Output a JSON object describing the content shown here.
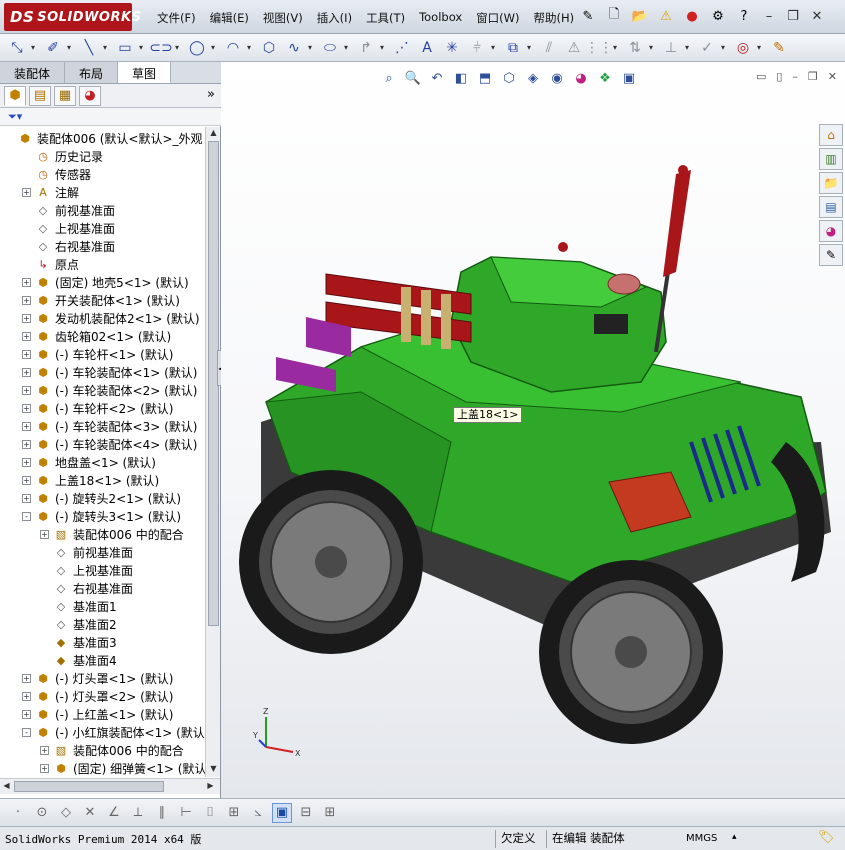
{
  "app": {
    "logo_ds": "DS",
    "logo_text": "SOLIDWORKS"
  },
  "menus": [
    "文件(F)",
    "编辑(E)",
    "视图(V)",
    "插入(I)",
    "工具(T)",
    "Toolbox",
    "窗口(W)",
    "帮助(H)"
  ],
  "command_manager_tabs": [
    "装配体",
    "布局",
    "草图"
  ],
  "active_command_tab": "草图",
  "feature_tree": [
    {
      "label": "装配体006  (默认<默认>_外观 显",
      "indent": 0,
      "expander": "",
      "icon": "asm"
    },
    {
      "label": "历史记录",
      "indent": 1,
      "expander": "",
      "icon": "hist"
    },
    {
      "label": "传感器",
      "indent": 1,
      "expander": "",
      "icon": "hist"
    },
    {
      "label": "注解",
      "indent": 1,
      "expander": "+",
      "icon": "note"
    },
    {
      "label": "前视基准面",
      "indent": 1,
      "expander": "",
      "icon": "plane"
    },
    {
      "label": "上视基准面",
      "indent": 1,
      "expander": "",
      "icon": "plane"
    },
    {
      "label": "右视基准面",
      "indent": 1,
      "expander": "",
      "icon": "plane"
    },
    {
      "label": "原点",
      "indent": 1,
      "expander": "",
      "icon": "orig"
    },
    {
      "label": "(固定) 地壳5<1> (默认)",
      "indent": 1,
      "expander": "+",
      "icon": "asm"
    },
    {
      "label": "开关装配体<1> (默认)",
      "indent": 1,
      "expander": "+",
      "icon": "asm"
    },
    {
      "label": "发动机装配体2<1> (默认)",
      "indent": 1,
      "expander": "+",
      "icon": "asm"
    },
    {
      "label": "齿轮箱02<1> (默认)",
      "indent": 1,
      "expander": "+",
      "icon": "asm"
    },
    {
      "label": "(-) 车轮杆<1> (默认)",
      "indent": 1,
      "expander": "+",
      "icon": "asm"
    },
    {
      "label": "(-) 车轮装配体<1> (默认)",
      "indent": 1,
      "expander": "+",
      "icon": "asm"
    },
    {
      "label": "(-) 车轮装配体<2> (默认)",
      "indent": 1,
      "expander": "+",
      "icon": "asm"
    },
    {
      "label": "(-) 车轮杆<2> (默认)",
      "indent": 1,
      "expander": "+",
      "icon": "asm"
    },
    {
      "label": "(-) 车轮装配体<3> (默认)",
      "indent": 1,
      "expander": "+",
      "icon": "asm"
    },
    {
      "label": "(-) 车轮装配体<4> (默认)",
      "indent": 1,
      "expander": "+",
      "icon": "asm"
    },
    {
      "label": "地盘盖<1> (默认)",
      "indent": 1,
      "expander": "+",
      "icon": "asm"
    },
    {
      "label": "上盖18<1> (默认)",
      "indent": 1,
      "expander": "+",
      "icon": "asm"
    },
    {
      "label": "(-) 旋转头2<1> (默认)",
      "indent": 1,
      "expander": "+",
      "icon": "asm"
    },
    {
      "label": "(-) 旋转头3<1> (默认)",
      "indent": 1,
      "expander": "-",
      "icon": "asm"
    },
    {
      "label": "装配体006 中的配合",
      "indent": 2,
      "expander": "+",
      "icon": "fold"
    },
    {
      "label": "前视基准面",
      "indent": 2,
      "expander": "",
      "icon": "plane"
    },
    {
      "label": "上视基准面",
      "indent": 2,
      "expander": "",
      "icon": "plane"
    },
    {
      "label": "右视基准面",
      "indent": 2,
      "expander": "",
      "icon": "plane"
    },
    {
      "label": "基准面1",
      "indent": 2,
      "expander": "",
      "icon": "plane"
    },
    {
      "label": "基准面2",
      "indent": 2,
      "expander": "",
      "icon": "plane"
    },
    {
      "label": "基准面3",
      "indent": 2,
      "expander": "",
      "icon": "planey"
    },
    {
      "label": "基准面4",
      "indent": 2,
      "expander": "",
      "icon": "planey"
    },
    {
      "label": "(-) 灯头罩<1> (默认)",
      "indent": 1,
      "expander": "+",
      "icon": "asm"
    },
    {
      "label": "(-) 灯头罩<2> (默认)",
      "indent": 1,
      "expander": "+",
      "icon": "asm"
    },
    {
      "label": "(-) 上红盖<1> (默认)",
      "indent": 1,
      "expander": "+",
      "icon": "asm"
    },
    {
      "label": "(-) 小红旗装配体<1> (默认)",
      "indent": 1,
      "expander": "-",
      "icon": "asm"
    },
    {
      "label": "装配体006 中的配合",
      "indent": 2,
      "expander": "+",
      "icon": "fold"
    },
    {
      "label": "(固定) 细弹簧<1> (默认)",
      "indent": 2,
      "expander": "+",
      "icon": "asm"
    }
  ],
  "viewport": {
    "tooltip": "上盖18<1>",
    "triad": {
      "x": "X",
      "y": "Y",
      "z": "Z"
    }
  },
  "status": {
    "product": "SolidWorks Premium 2014 x64 版",
    "state": "欠定义",
    "mode": "在编辑 装配体",
    "units": "MMGS"
  },
  "colors": {
    "tank_body": "#2fa82a",
    "tank_dark": "#1f7a1c",
    "barrel": "#a8161a",
    "accent_purple": "#9a2aa0",
    "logo_red": "#b0151b"
  }
}
